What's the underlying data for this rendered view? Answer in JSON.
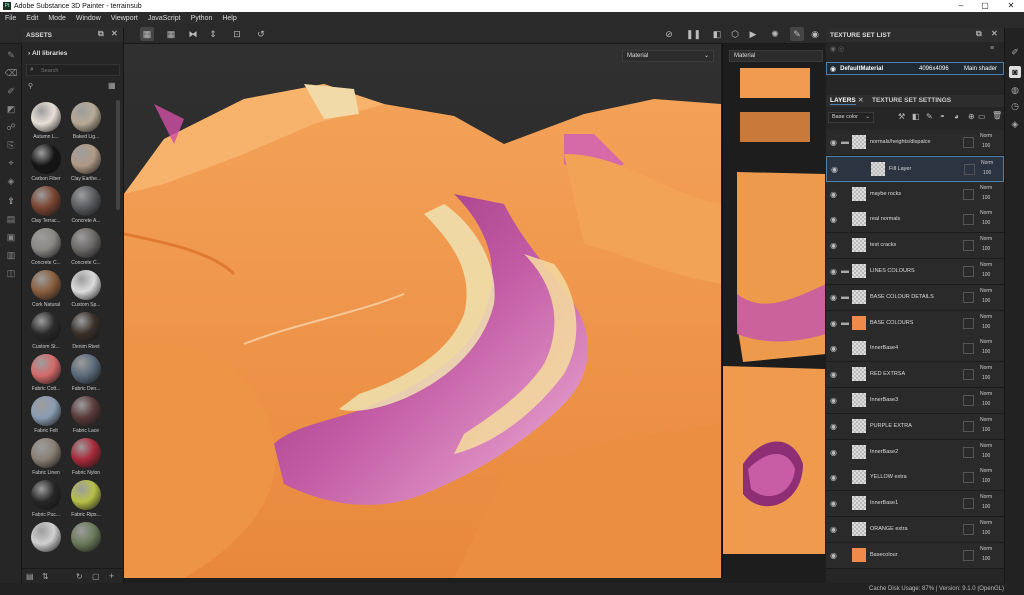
{
  "window": {
    "title": "Adobe Substance 3D Painter - terrainsub",
    "app_icon": "Pt",
    "controls": [
      "–",
      "▢",
      "✕"
    ]
  },
  "menu": [
    "File",
    "Edit",
    "Mode",
    "Window",
    "Viewport",
    "JavaScript",
    "Python",
    "Help"
  ],
  "assets": {
    "title": "ASSETS",
    "library": "All libraries",
    "search_placeholder": "Search",
    "items": [
      {
        "label": "Autumn L...",
        "color": "#e7e0d6"
      },
      {
        "label": "Baked Lig...",
        "color": "#b7aa96"
      },
      {
        "label": "Carbon Fiber",
        "color": "#151515"
      },
      {
        "label": "Clay Earthe...",
        "color": "#b19a86"
      },
      {
        "label": "Clay Terrac...",
        "color": "#7a4431"
      },
      {
        "label": "Concrete A...",
        "color": "#595b5e"
      },
      {
        "label": "Concrete C...",
        "color": "#8a8885"
      },
      {
        "label": "Concrete C...",
        "color": "#6b6966"
      },
      {
        "label": "Cork Natural",
        "color": "#8a5e3e"
      },
      {
        "label": "Custom Sp...",
        "color": "#dcdcdc"
      },
      {
        "label": "Custom St...",
        "color": "#2a2a2a"
      },
      {
        "label": "Denim Rivet",
        "color": "#3a302a"
      },
      {
        "label": "Fabric Cott...",
        "color": "#d46a6a"
      },
      {
        "label": "Fabric Den...",
        "color": "#5a6a7a"
      },
      {
        "label": "Fabric Felt",
        "color": "#8b9db3"
      },
      {
        "label": "Fabric Lace",
        "color": "#5a3a3a"
      },
      {
        "label": "Fabric Linen",
        "color": "#8a7f74"
      },
      {
        "label": "Fabric Nylon",
        "color": "#a82a3a"
      },
      {
        "label": "Fabric Puc...",
        "color": "#262626"
      },
      {
        "label": "Fabric Rips...",
        "color": "#b7c048"
      },
      {
        "label": "",
        "color": "#d0d0d0"
      },
      {
        "label": "",
        "color": "#6b7a5a"
      }
    ]
  },
  "viewport": {
    "mode_3d": "Material",
    "mode_2d": "Material"
  },
  "texture_set_list": {
    "title": "TEXTURE SET LIST",
    "set": {
      "name": "DefaultMaterial",
      "resolution": "4096x4096",
      "shader": "Main shader"
    }
  },
  "layers_panel": {
    "tab_layers": "LAYERS",
    "tab_settings": "TEXTURE SET SETTINGS",
    "channel": "Base color",
    "layers": [
      {
        "name": "normals/heights/dispalce",
        "type": "folder",
        "thumb": "checker",
        "blend": "Norm",
        "opacity": "100"
      },
      {
        "name": "Fill Layer",
        "type": "fill",
        "thumb": "checker",
        "blend": "Norm",
        "opacity": "100",
        "selected": true
      },
      {
        "name": "maybe rocks",
        "type": "layer",
        "thumb": "checker",
        "blend": "Norm",
        "opacity": "100"
      },
      {
        "name": "real normals",
        "type": "layer",
        "thumb": "checker",
        "blend": "Norm",
        "opacity": "100"
      },
      {
        "name": "test cracks",
        "type": "layer",
        "thumb": "checker",
        "blend": "Norm",
        "opacity": "100"
      },
      {
        "name": "LINES COLOURS",
        "type": "folder",
        "thumb": "checker",
        "blend": "Norm",
        "opacity": "100"
      },
      {
        "name": "BASE COLOUR DETAILS",
        "type": "folder",
        "thumb": "checker",
        "blend": "Norm",
        "opacity": "100"
      },
      {
        "name": "BASE COLOURS",
        "type": "folder",
        "thumb": "orange",
        "blend": "Norm",
        "opacity": "100"
      },
      {
        "name": "InnerBase4",
        "type": "layer",
        "thumb": "checker",
        "blend": "Norm",
        "opacity": "100"
      },
      {
        "name": "RED EXTRSA",
        "type": "layer",
        "thumb": "checker",
        "blend": "Norm",
        "opacity": "100"
      },
      {
        "name": "InnerBase3",
        "type": "layer",
        "thumb": "checker",
        "blend": "Norm",
        "opacity": "100"
      },
      {
        "name": "PURPLE EXTRA",
        "type": "layer",
        "thumb": "checker",
        "blend": "Norm",
        "opacity": "100"
      },
      {
        "name": "InnerBase2",
        "type": "layer",
        "thumb": "checker",
        "blend": "Norm",
        "opacity": "100"
      },
      {
        "name": "YELLOW extra",
        "type": "layer",
        "thumb": "checker",
        "blend": "Norm",
        "opacity": "100"
      },
      {
        "name": "InnerBase1",
        "type": "layer",
        "thumb": "checker",
        "blend": "Norm",
        "opacity": "100"
      },
      {
        "name": "ORANGE extra",
        "type": "layer",
        "thumb": "checker",
        "blend": "Norm",
        "opacity": "100"
      },
      {
        "name": "Basecolour",
        "type": "layer",
        "thumb": "orange",
        "blend": "Norm",
        "opacity": "100"
      }
    ]
  },
  "status": {
    "text": "Cache Disk Usage:  87% | Version: 9.1.0 (OpenGL)"
  },
  "colors": {
    "terrain_orange": "#f2994a",
    "terrain_purple": "#b0478f",
    "terrain_cream": "#efe3b2",
    "selection_blue": "#4a80b0"
  }
}
